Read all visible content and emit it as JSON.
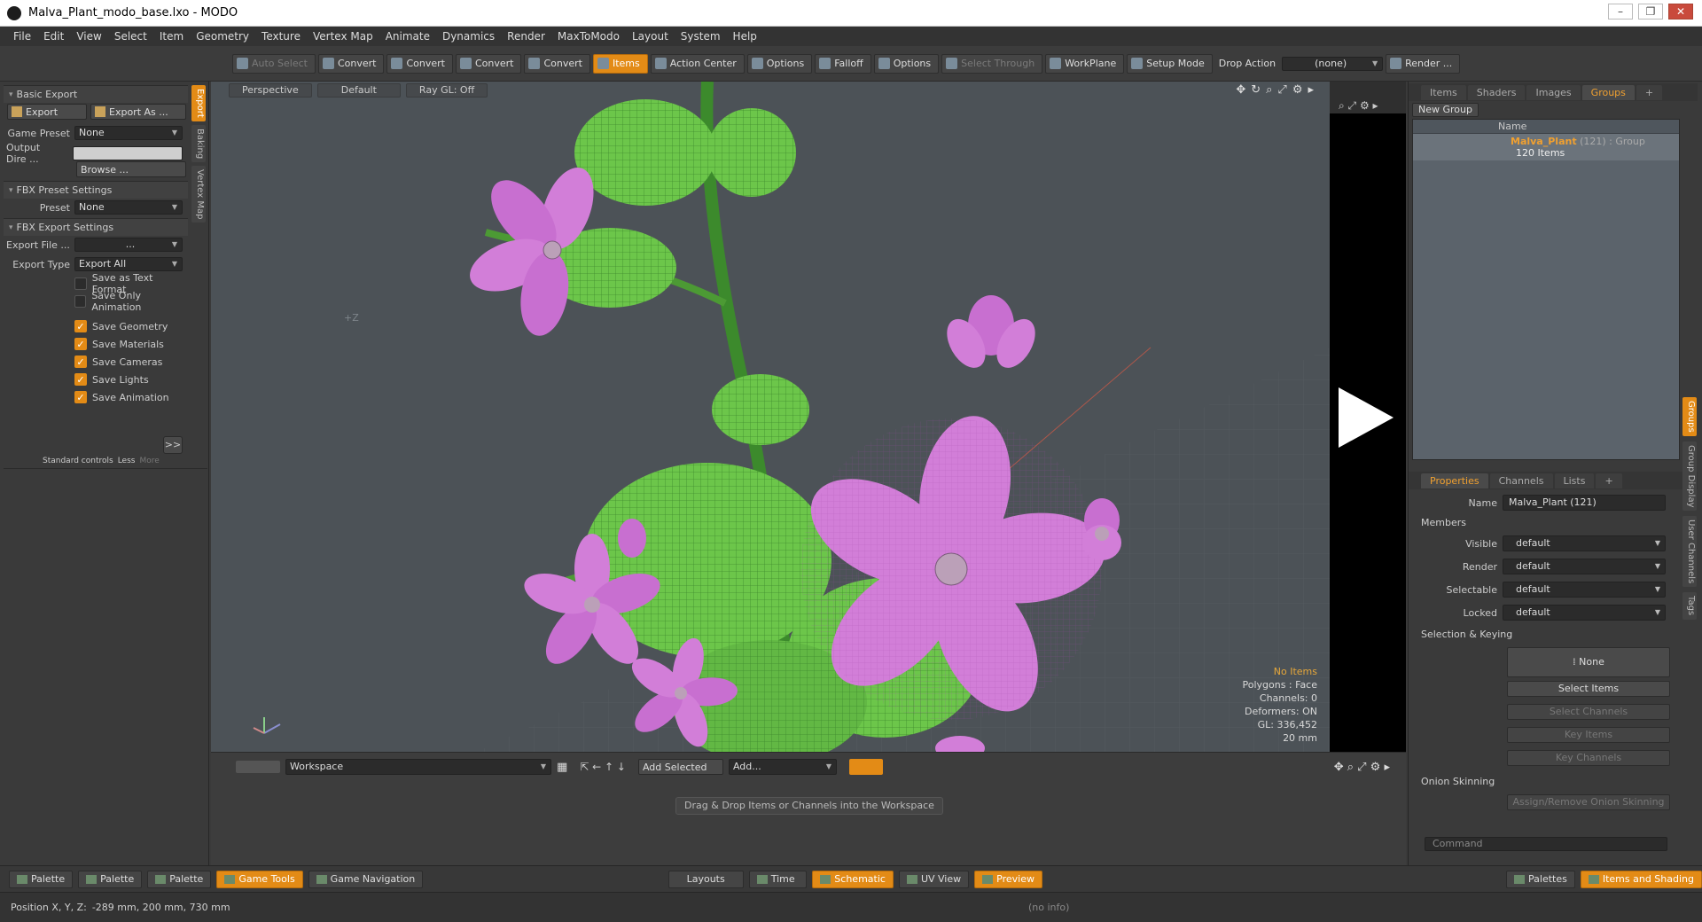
{
  "window": {
    "title": "Malva_Plant_modo_base.lxo - MODO",
    "controls": [
      "–",
      "❐",
      "✕"
    ]
  },
  "menu": [
    "File",
    "Edit",
    "View",
    "Select",
    "Item",
    "Geometry",
    "Texture",
    "Vertex Map",
    "Animate",
    "Dynamics",
    "Render",
    "MaxToModo",
    "Layout",
    "System",
    "Help"
  ],
  "toolbar": {
    "items": [
      {
        "label": "Auto Select",
        "state": "dim"
      },
      {
        "label": "Convert",
        "state": ""
      },
      {
        "label": "Convert",
        "state": ""
      },
      {
        "label": "Convert",
        "state": ""
      },
      {
        "label": "Convert",
        "state": ""
      },
      {
        "label": "Items",
        "state": "active"
      },
      {
        "label": "Action Center",
        "state": ""
      },
      {
        "label": "Options",
        "state": ""
      },
      {
        "label": "Falloff",
        "state": ""
      },
      {
        "label": "Options",
        "state": ""
      },
      {
        "label": "Select Through",
        "state": "dim"
      },
      {
        "label": "WorkPlane",
        "state": ""
      },
      {
        "label": "Setup Mode",
        "state": ""
      }
    ],
    "drop_action_label": "Drop Action",
    "drop_action_value": "(none)",
    "render_label": "Render ..."
  },
  "left": {
    "tabs": [
      "Export",
      "Baking",
      "Vertex Map"
    ],
    "basic_export": "Basic Export",
    "export_btn": "Export",
    "export_as_btn": "Export As ...",
    "game_preset_label": "Game Preset",
    "game_preset_value": "None",
    "output_dir_label": "Output Dire ...",
    "output_dir_value": "",
    "browse": "Browse ...",
    "fbx_preset_settings": "FBX Preset Settings",
    "preset_label": "Preset",
    "preset_value": "None",
    "fbx_export_settings": "FBX Export Settings",
    "export_file_label": "Export File  ...",
    "export_file_value": "...",
    "export_type_label": "Export Type",
    "export_type_value": "Export All",
    "checks": [
      {
        "label": "Save as Text Format",
        "on": false
      },
      {
        "label": "Save Only Animation",
        "on": false
      },
      {
        "label": "Save Geometry",
        "on": true
      },
      {
        "label": "Save Materials",
        "on": true
      },
      {
        "label": "Save Cameras",
        "on": true
      },
      {
        "label": "Save Lights",
        "on": true
      },
      {
        "label": "Save Animation",
        "on": true
      }
    ],
    "more_btn": ">>",
    "standard_controls": "Standard controls",
    "less": "Less",
    "more": "More"
  },
  "viewport": {
    "view": "Perspective",
    "shading": "Default",
    "raygl": "Ray GL: Off",
    "axis_label": "+Z",
    "info": {
      "selection": "No Items",
      "polygons": "Polygons : Face",
      "channels": "Channels: 0",
      "deformers": "Deformers: ON",
      "gl": "GL: 336,452",
      "scale": "20 mm"
    }
  },
  "schematic": {
    "workspace": "Workspace",
    "add_selected": "Add Selected",
    "add": "Add...",
    "drag_msg": "Drag & Drop Items or Channels into the Workspace"
  },
  "right": {
    "top_tabs": [
      "Items",
      "Shaders",
      "Images",
      "Groups",
      "+"
    ],
    "new_group": "New Group",
    "list_header": "Name",
    "group": {
      "name": "Malva_Plant",
      "count": "(121)",
      "type": ": Group",
      "sub": "120 Items"
    },
    "prop_tabs": [
      "Properties",
      "Channels",
      "Lists",
      "+"
    ],
    "name_label": "Name",
    "name_value": "Malva_Plant (121)",
    "members": "Members",
    "props": [
      {
        "label": "Visible",
        "value": "default"
      },
      {
        "label": "Render",
        "value": "default"
      },
      {
        "label": "Selectable",
        "value": "default"
      },
      {
        "label": "Locked",
        "value": "default"
      }
    ],
    "selection_keying": "Selection & Keying",
    "none_btn": "None",
    "select_items": "Select Items",
    "select_channels": "Select Channels",
    "key_items": "Key Items",
    "key_channels": "Key Channels",
    "onion": "Onion Skinning",
    "onion_btn": "Assign/Remove Onion Skinning",
    "vtabs": [
      "Groups",
      "Group Display",
      "User Channels",
      "Tags"
    ],
    "command_placeholder": "Command"
  },
  "bottom": {
    "left": [
      "Palette",
      "Palette",
      "Palette"
    ],
    "game_tools": "Game Tools",
    "game_nav": "Game Navigation",
    "center": [
      {
        "label": "Layouts",
        "active": false
      },
      {
        "label": "Time",
        "active": false
      },
      {
        "label": "Schematic",
        "active": true
      },
      {
        "label": "UV View",
        "active": false
      },
      {
        "label": "Preview",
        "active": true
      }
    ],
    "palettes": "Palettes",
    "items_shading": "Items and Shading"
  },
  "status": {
    "position_label": "Position X, Y, Z:",
    "position_value": "-289 mm, 200 mm, 730 mm",
    "info": "(no info)"
  },
  "colors": {
    "accent": "#e38b16",
    "petal": "#d27ed8",
    "leaf": "#6cc64a",
    "stem": "#3c8a2c"
  }
}
